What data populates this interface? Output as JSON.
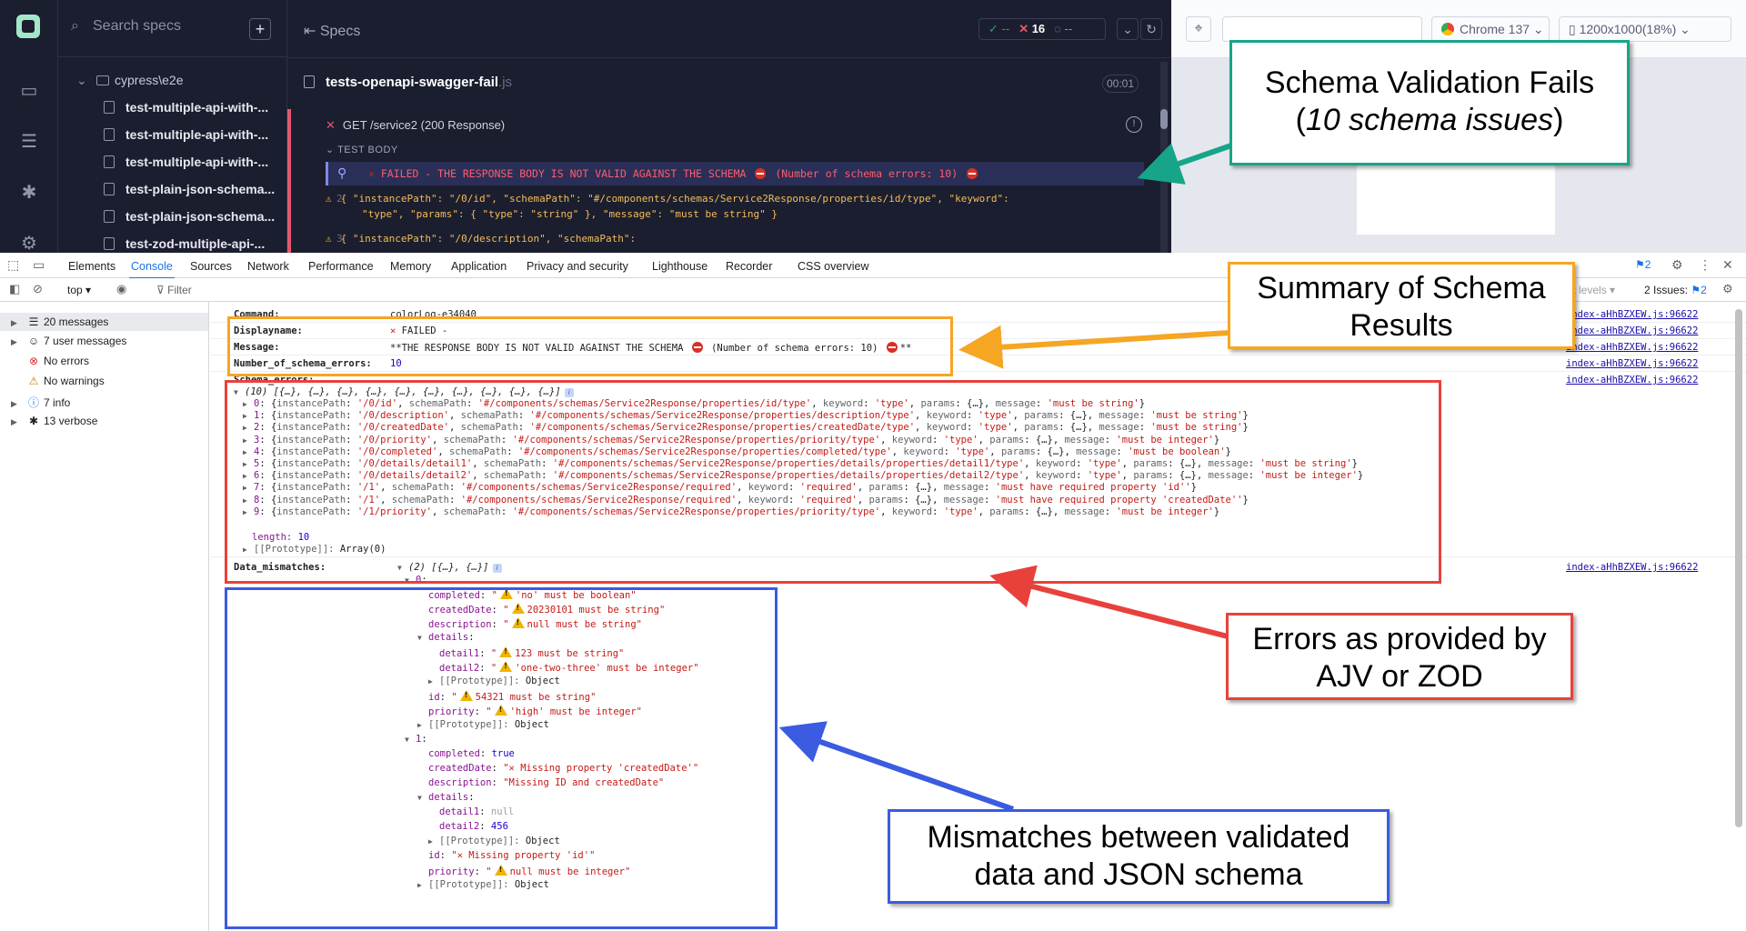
{
  "cypress": {
    "search": {
      "placeholder": "Search specs"
    },
    "tree": {
      "folder": "cypress\\e2e",
      "files": [
        "test-multiple-api-with-...",
        "test-multiple-api-with-...",
        "test-multiple-api-with-...",
        "test-plain-json-schema...",
        "test-plain-json-schema...",
        "test-zod-multiple-api-..."
      ]
    },
    "runner": {
      "header_label": "Specs",
      "stats": {
        "passed": "--",
        "failed": "16",
        "pending": "--"
      },
      "spec_name": "tests-openapi-swagger-fail",
      "spec_ext": ".js",
      "duration": "00:01",
      "test_title": "GET /service2 (200 Response)",
      "body_label": "TEST BODY",
      "fail_line": "FAILED - THE RESPONSE BODY IS NOT VALID AGAINST THE SCHEMA",
      "fail_count": "(Number of schema errors: 10)",
      "code_lines": [
        {
          "num": "2",
          "text": "{ \"instancePath\": \"/0/id\", \"schemaPath\": \"#/components/schemas/Service2Response/properties/id/type\", \"keyword\":",
          "cont": "\"type\", \"params\": { \"type\": \"string\" }, \"message\": \"must be string\" }"
        },
        {
          "num": "3",
          "text": "{ \"instancePath\": \"/0/description\", \"schemaPath\":",
          "cont": ""
        }
      ]
    },
    "preview": {
      "browser": "Chrome 137",
      "viewport": "1200x1000(18%)"
    }
  },
  "devtools": {
    "tabs": [
      "Elements",
      "Console",
      "Sources",
      "Network",
      "Performance",
      "Memory",
      "Application",
      "Privacy and security",
      "Lighthouse",
      "Recorder",
      "CSS overview"
    ],
    "active_tab": "Console",
    "messages_badge": "2",
    "toolbar": {
      "context": "top",
      "filter_placeholder": "Filter",
      "levels": "ult levels",
      "issues_label": "2 Issues:",
      "issues_count": "2"
    },
    "sidebar": [
      {
        "label": "20 messages",
        "icon": "list-icon"
      },
      {
        "label": "7 user messages",
        "icon": "user-icon"
      },
      {
        "label": "No errors",
        "icon": "error-icon"
      },
      {
        "label": "No warnings",
        "icon": "warning-icon"
      },
      {
        "label": "7 info",
        "icon": "info-icon"
      },
      {
        "label": "13 verbose",
        "icon": "bug-icon"
      }
    ],
    "source_link": "index-aHhBZXEW.js:96622",
    "log": {
      "command_key": "Command:",
      "command_val": "colorLog-e34040",
      "displayname_key": "Displayname:",
      "displayname_val": "FAILED -",
      "message_key": "Message:",
      "message_pre": "**THE RESPONSE BODY IS NOT VALID AGAINST THE SCHEMA",
      "message_mid": "(Number of schema errors: 10)",
      "message_post": "**",
      "num_errors_key": "Number_of_schema_errors:",
      "num_errors_val": "10",
      "schema_errors_key": "Schema_errors:",
      "schema_errors_summary": "(10) [{…}, {…}, {…}, {…}, {…}, {…}, {…}, {…}, {…}, {…}]",
      "schema_errors": [
        {
          "i": "0",
          "path": "'/0/id'",
          "schema": "'#/components/schemas/Service2Response/properties/id/type'",
          "kw": "'type'",
          "msg": "'must be string'"
        },
        {
          "i": "1",
          "path": "'/0/description'",
          "schema": "'#/components/schemas/Service2Response/properties/description/type'",
          "kw": "'type'",
          "msg": "'must be string'"
        },
        {
          "i": "2",
          "path": "'/0/createdDate'",
          "schema": "'#/components/schemas/Service2Response/properties/createdDate/type'",
          "kw": "'type'",
          "msg": "'must be string'"
        },
        {
          "i": "3",
          "path": "'/0/priority'",
          "schema": "'#/components/schemas/Service2Response/properties/priority/type'",
          "kw": "'type'",
          "msg": "'must be integer'"
        },
        {
          "i": "4",
          "path": "'/0/completed'",
          "schema": "'#/components/schemas/Service2Response/properties/completed/type'",
          "kw": "'type'",
          "msg": "'must be boolean'"
        },
        {
          "i": "5",
          "path": "'/0/details/detail1'",
          "schema": "'#/components/schemas/Service2Response/properties/details/properties/detail1/type'",
          "kw": "'type'",
          "msg": "'must be string'"
        },
        {
          "i": "6",
          "path": "'/0/details/detail2'",
          "schema": "'#/components/schemas/Service2Response/properties/details/properties/detail2/type'",
          "kw": "'type'",
          "msg": "'must be integer'"
        },
        {
          "i": "7",
          "path": "'/1'",
          "schema": "'#/components/schemas/Service2Response/required'",
          "kw": "'required'",
          "msg": "'must have required property 'id''"
        },
        {
          "i": "8",
          "path": "'/1'",
          "schema": "'#/components/schemas/Service2Response/required'",
          "kw": "'required'",
          "msg": "'must have required property 'createdDate''"
        },
        {
          "i": "9",
          "path": "'/1/priority'",
          "schema": "'#/components/schemas/Service2Response/properties/priority/type'",
          "kw": "'type'",
          "msg": "'must be integer'"
        }
      ],
      "length_key": "length:",
      "length_val": "10",
      "proto_key": "[[Prototype]]:",
      "proto_array": "Array(0)",
      "proto_object": "Object",
      "data_mismatches_key": "Data_mismatches:",
      "data_mismatches_summary": "(2) [{…}, {…}]",
      "mm0": {
        "completed": "'no' must be boolean",
        "createdDate": "20230101 must be string",
        "description": "null must be string",
        "detail1": "123 must be string",
        "detail2": "'one-two-three' must be integer",
        "id": "54321 must be string",
        "priority": "'high' must be integer"
      },
      "mm1": {
        "completed": "true",
        "createdDate": "Missing property 'createdDate'",
        "description": "Missing ID and createdDate",
        "detail1": "null",
        "detail2": "456",
        "id": "Missing property 'id'",
        "priority": "null must be integer"
      }
    }
  },
  "annotations": {
    "schema_fails": {
      "line1": "Schema Validation Fails",
      "line2": "10 schema issues",
      "color": "#17a589"
    },
    "summary": {
      "line1": "Summary of Schema",
      "line2": "Results",
      "color": "#f5a623"
    },
    "errors": {
      "line1": "Errors as provided by",
      "line2": "AJV or ZOD",
      "color": "#e8413c"
    },
    "mismatches": {
      "line1": "Mismatches between validated",
      "line2": "data and JSON schema",
      "color": "#3b5be0"
    }
  }
}
